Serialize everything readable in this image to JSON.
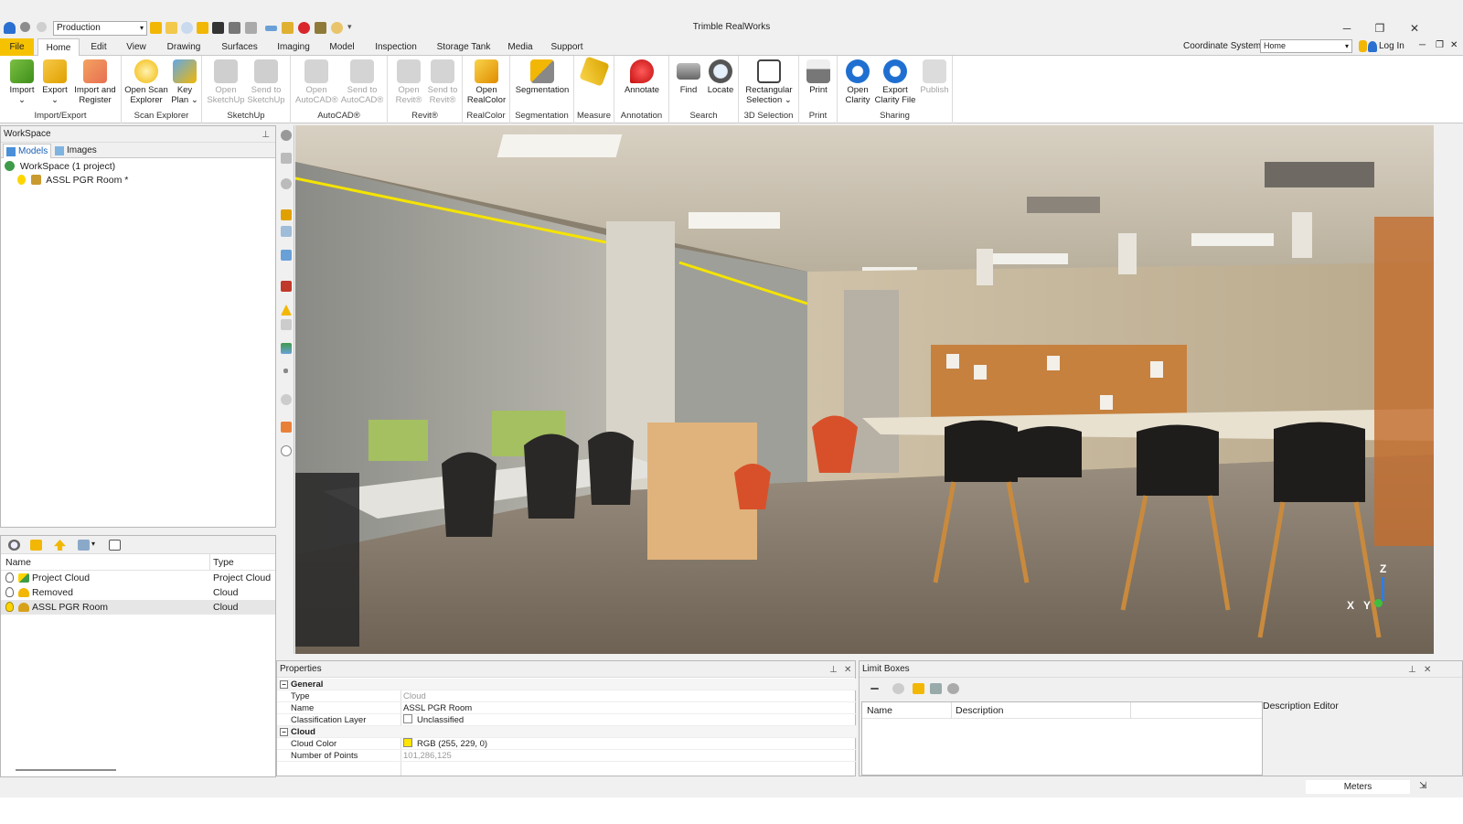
{
  "window": {
    "title": "Trimble RealWorks",
    "profile": "Production"
  },
  "tabs": [
    "File",
    "Home",
    "Edit",
    "View",
    "Drawing",
    "Surfaces",
    "Imaging",
    "Model",
    "Inspection",
    "Storage Tank",
    "Media",
    "Support"
  ],
  "header_right": {
    "coordinate_label": "Coordinate System",
    "coordinate_value": "Home",
    "login": "Log In"
  },
  "ribbon": {
    "groups": [
      {
        "label": "Import/Export",
        "buttons": [
          [
            "Import",
            "⌄"
          ],
          [
            "Export",
            "⌄"
          ],
          [
            "Import and",
            "Register"
          ]
        ]
      },
      {
        "label": "Scan Explorer",
        "buttons": [
          [
            "Open Scan",
            "Explorer"
          ],
          [
            "Key",
            "Plan ⌄"
          ]
        ]
      },
      {
        "label": "SketchUp",
        "buttons": [
          [
            "Open",
            "SketchUp"
          ],
          [
            "Send to",
            "SketchUp"
          ]
        ]
      },
      {
        "label": "AutoCAD®",
        "buttons": [
          [
            "Open",
            "AutoCAD®"
          ],
          [
            "Send to",
            "AutoCAD®"
          ]
        ]
      },
      {
        "label": "Revit®",
        "buttons": [
          [
            "Open",
            "Revit®"
          ],
          [
            "Send to",
            "Revit®"
          ]
        ]
      },
      {
        "label": "RealColor",
        "buttons": [
          [
            "Open",
            "RealColor"
          ]
        ]
      },
      {
        "label": "Segmentation",
        "buttons": [
          [
            "Segmentation",
            ""
          ]
        ]
      },
      {
        "label": "Measure",
        "buttons": [
          [
            "",
            ""
          ]
        ]
      },
      {
        "label": "Annotation",
        "buttons": [
          [
            "Annotate",
            ""
          ]
        ]
      },
      {
        "label": "Search",
        "buttons": [
          [
            "Find",
            ""
          ],
          [
            "Locate",
            ""
          ]
        ]
      },
      {
        "label": "3D Selection",
        "buttons": [
          [
            "Rectangular",
            "Selection ⌄"
          ]
        ]
      },
      {
        "label": "Print",
        "buttons": [
          [
            "Print",
            ""
          ]
        ]
      },
      {
        "label": "Sharing",
        "buttons": [
          [
            "Open",
            "Clarity"
          ],
          [
            "Export",
            "Clarity File"
          ],
          [
            "Publish",
            ""
          ]
        ]
      }
    ]
  },
  "workspace": {
    "title": "WorkSpace",
    "tabs": [
      "Models",
      "Images"
    ],
    "tree": [
      "WorkSpace  (1 project)",
      "ASSL PGR Room  *"
    ]
  },
  "object_list": {
    "columns": [
      "Name",
      "Type"
    ],
    "rows": [
      {
        "name": "Project Cloud",
        "type": "Project Cloud"
      },
      {
        "name": "Removed",
        "type": "Cloud"
      },
      {
        "name": "ASSL PGR Room",
        "type": "Cloud"
      }
    ]
  },
  "properties": {
    "title": "Properties",
    "rows": [
      {
        "key": "General",
        "value": ""
      },
      {
        "key": "Type",
        "value": "Cloud"
      },
      {
        "key": "Name",
        "value": "ASSL PGR Room"
      },
      {
        "key": "Classification Layer",
        "value": "Unclassified"
      },
      {
        "key": "Cloud",
        "value": ""
      },
      {
        "key": "Cloud Color",
        "value": "RGB (255, 229, 0)"
      },
      {
        "key": "Number of Points",
        "value": "101,286,125"
      }
    ],
    "cloud_color_hex": "#ffe500"
  },
  "limit_boxes": {
    "title": "Limit Boxes",
    "columns": [
      "Name",
      "Description"
    ],
    "description_editor": "Description Editor"
  },
  "viewport": {
    "axis_z": "Z",
    "axis_x": "X",
    "axis_y": "Y"
  },
  "status": {
    "units": "Meters"
  },
  "colors": {
    "accent": "#f6c200",
    "selection": "#e6e6e6",
    "panel_bg": "#f0f0f0"
  }
}
